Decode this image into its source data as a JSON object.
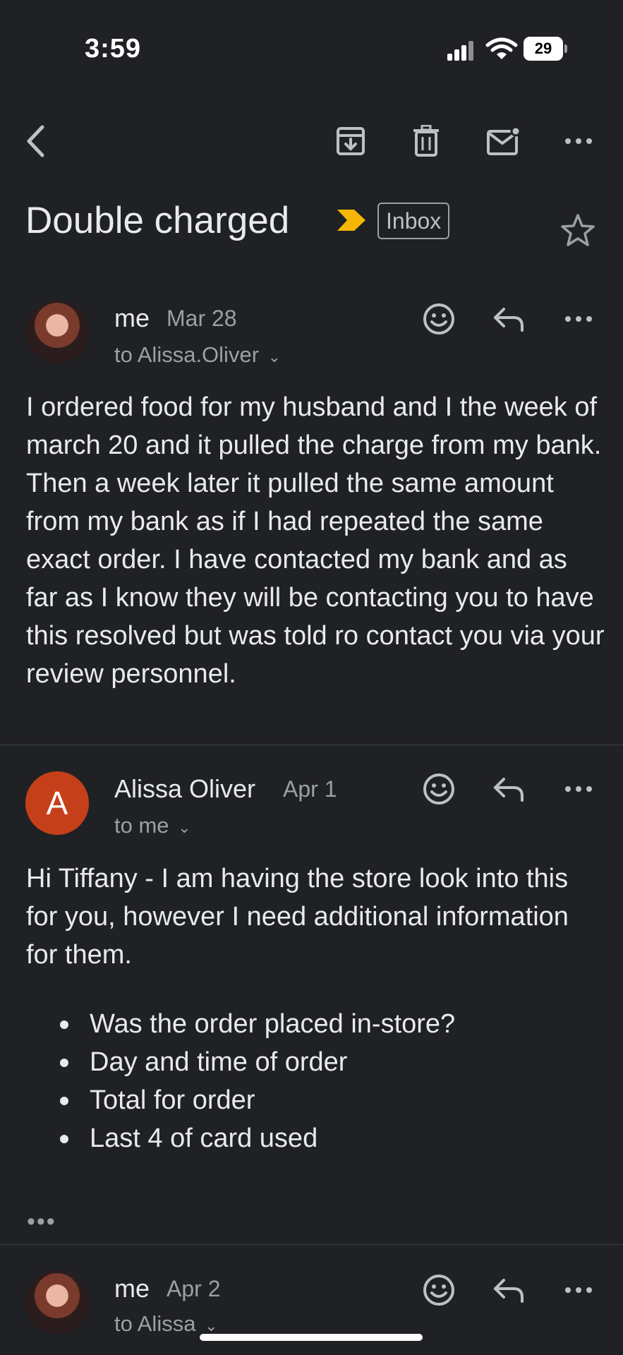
{
  "status_bar": {
    "time": "3:59",
    "battery": "29"
  },
  "thread": {
    "subject": "Double charged",
    "label": "Inbox"
  },
  "messages": [
    {
      "sender": "me",
      "date": "Mar 28",
      "to": "to Alissa.Oliver",
      "body": "I ordered food for my husband and I the week of march 20 and it pulled the charge from my bank. Then a week later it pulled the same amount from my bank as if I had repeated the same exact order. I have contacted my bank and as far as I know they will be contacting you to have this resolved but was told ro contact you via your review personnel."
    },
    {
      "sender": "Alissa Oliver",
      "avatar_letter": "A",
      "date": "Apr 1",
      "to": "to me",
      "body": "Hi Tiffany - I am having the store look into this for you, however I need additional information for them.",
      "bullets": [
        "Was the order placed in-store?",
        "Day and time of order",
        "Total for order",
        "Last 4 of card used"
      ],
      "trimmed": "•••"
    },
    {
      "sender": "me",
      "date": "Apr 2",
      "to": "to Alissa"
    }
  ],
  "icons": {
    "back": "back-arrow-icon",
    "archive": "archive-icon",
    "delete": "trash-icon",
    "mark_unread": "mark-unread-icon",
    "more": "more-horizontal-icon",
    "importance": "importance-marker-icon",
    "star": "star-icon",
    "emoji": "emoji-reaction-icon",
    "reply": "reply-icon"
  },
  "colors": {
    "background": "#202124",
    "importance": "#f6b704",
    "avatar_a": "#c5401a"
  }
}
